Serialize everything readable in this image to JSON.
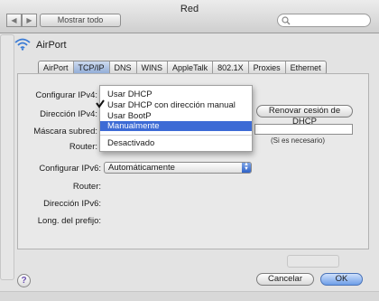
{
  "window": {
    "title": "Red",
    "show_all_label": "Mostrar todo"
  },
  "device": {
    "name": "AirPort",
    "icon": "wifi-icon"
  },
  "tabs": [
    {
      "label": "AirPort"
    },
    {
      "label": "TCP/IP",
      "selected": true
    },
    {
      "label": "DNS"
    },
    {
      "label": "WINS"
    },
    {
      "label": "AppleTalk"
    },
    {
      "label": "802.1X"
    },
    {
      "label": "Proxies"
    },
    {
      "label": "Ethernet"
    }
  ],
  "form": {
    "ipv4_label": "Configurar IPv4:",
    "address_label": "Dirección IPv4:",
    "subnet_label": "Máscara subred:",
    "router_label": "Router:",
    "renew_button": "Renovar cesión de DHCP",
    "client_hint": "(Si es necesario)",
    "ipv6_label": "Configurar IPv6:",
    "ipv6_value": "Automáticamente",
    "router6_label": "Router:",
    "address6_label": "Dirección IPv6:",
    "prefix_label": "Long. del prefijo:"
  },
  "ipv4_menu": {
    "items": [
      {
        "label": "Usar DHCP"
      },
      {
        "label": "Usar DHCP con dirección manual",
        "checked": true
      },
      {
        "label": "Usar BootP"
      },
      {
        "label": "Manualmente",
        "highlighted": true
      },
      {
        "label": "Desactivado"
      }
    ]
  },
  "buttons": {
    "cancel": "Cancelar",
    "ok": "OK",
    "help": "?"
  },
  "colors": {
    "selection": "#3d6bd5",
    "tab_selected": "#8eaad6",
    "default_button": "#6d9ee8"
  }
}
